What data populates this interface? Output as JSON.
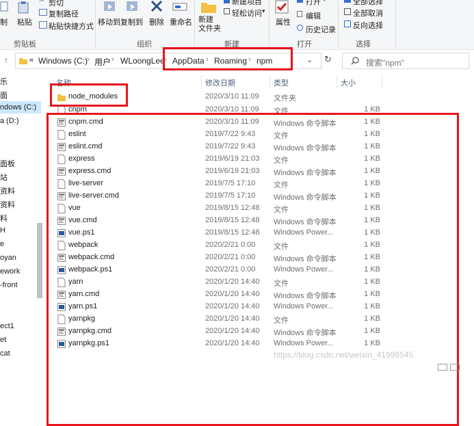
{
  "ribbon": {
    "clipboard": {
      "cut": "剪切",
      "copy_path": "复制路径",
      "paste_shortcut": "粘贴快捷方式",
      "copy": "制",
      "paste": "粘贴",
      "group": "剪贴板"
    },
    "organize": {
      "move_to": "移动到",
      "copy_to": "复制到",
      "delete": "删除",
      "rename": "重命名",
      "group": "组织"
    },
    "new": {
      "new_item": "新建项目",
      "easy_access": "轻松访问",
      "new_folder": "新建\n文件夹",
      "group": "新建"
    },
    "open": {
      "properties": "属性",
      "open": "打开",
      "edit": "编辑",
      "history": "历史记录",
      "group": "打开"
    },
    "select": {
      "select_all": "全部选择",
      "select_none": "全部取消",
      "invert": "反向选择",
      "group": "选择"
    }
  },
  "address": {
    "overflow": "«",
    "crumbs": [
      "Windows (C:)",
      "用户",
      "WLoongLee",
      "AppData",
      "Roaming",
      "npm"
    ],
    "search_placeholder": "搜索\"npm\""
  },
  "nav": {
    "items": [
      "乐",
      "面",
      "ndows (C:)",
      "a (D:)",
      "面板",
      "站",
      "资料",
      "资料",
      "料",
      "H",
      "e",
      "oyan",
      "ework",
      "-front",
      "ect1",
      "et",
      "cat"
    ],
    "selected_index": 2
  },
  "columns": {
    "name": "名称",
    "date": "修改日期",
    "type": "类型",
    "size": "大小"
  },
  "files": [
    {
      "name": "node_modules",
      "date": "2020/3/10 11:09",
      "type": "文件夹",
      "size": "",
      "icon": "folder-icon"
    },
    {
      "name": "cnpm",
      "date": "2020/3/10 11:09",
      "type": "文件",
      "size": "1 KB",
      "icon": "file-icon"
    },
    {
      "name": "cnpm.cmd",
      "date": "2020/3/10 11:09",
      "type": "Windows 命令脚本",
      "size": "1 KB",
      "icon": "cmd-icon"
    },
    {
      "name": "eslint",
      "date": "2019/7/22 9:43",
      "type": "文件",
      "size": "1 KB",
      "icon": "file-icon"
    },
    {
      "name": "eslint.cmd",
      "date": "2019/7/22 9:43",
      "type": "Windows 命令脚本",
      "size": "1 KB",
      "icon": "cmd-icon"
    },
    {
      "name": "express",
      "date": "2019/6/19 21:03",
      "type": "文件",
      "size": "1 KB",
      "icon": "file-icon"
    },
    {
      "name": "express.cmd",
      "date": "2019/6/19 21:03",
      "type": "Windows 命令脚本",
      "size": "1 KB",
      "icon": "cmd-icon"
    },
    {
      "name": "live-server",
      "date": "2019/7/5 17:10",
      "type": "文件",
      "size": "1 KB",
      "icon": "file-icon"
    },
    {
      "name": "live-server.cmd",
      "date": "2019/7/5 17:10",
      "type": "Windows 命令脚本",
      "size": "1 KB",
      "icon": "cmd-icon"
    },
    {
      "name": "vue",
      "date": "2019/8/15 12:48",
      "type": "文件",
      "size": "1 KB",
      "icon": "file-icon"
    },
    {
      "name": "vue.cmd",
      "date": "2019/8/15 12:48",
      "type": "Windows 命令脚本",
      "size": "1 KB",
      "icon": "cmd-icon"
    },
    {
      "name": "vue.ps1",
      "date": "2019/8/15 12:48",
      "type": "Windows Power...",
      "size": "1 KB",
      "icon": "ps1-icon"
    },
    {
      "name": "webpack",
      "date": "2020/2/21 0:00",
      "type": "文件",
      "size": "1 KB",
      "icon": "file-icon"
    },
    {
      "name": "webpack.cmd",
      "date": "2020/2/21 0:00",
      "type": "Windows 命令脚本",
      "size": "1 KB",
      "icon": "cmd-icon"
    },
    {
      "name": "webpack.ps1",
      "date": "2020/2/21 0:00",
      "type": "Windows Power...",
      "size": "1 KB",
      "icon": "ps1-icon"
    },
    {
      "name": "yarn",
      "date": "2020/1/20 14:40",
      "type": "文件",
      "size": "1 KB",
      "icon": "file-icon"
    },
    {
      "name": "yarn.cmd",
      "date": "2020/1/20 14:40",
      "type": "Windows 命令脚本",
      "size": "1 KB",
      "icon": "cmd-icon"
    },
    {
      "name": "yarn.ps1",
      "date": "2020/1/20 14:40",
      "type": "Windows Power...",
      "size": "1 KB",
      "icon": "ps1-icon"
    },
    {
      "name": "yarnpkg",
      "date": "2020/1/20 14:40",
      "type": "文件",
      "size": "1 KB",
      "icon": "file-icon"
    },
    {
      "name": "yarnpkg.cmd",
      "date": "2020/1/20 14:40",
      "type": "Windows 命令脚本",
      "size": "1 KB",
      "icon": "cmd-icon"
    },
    {
      "name": "yarnpkg.ps1",
      "date": "2020/1/20 14:40",
      "type": "Windows Power...",
      "size": "1 KB",
      "icon": "ps1-icon"
    }
  ],
  "watermark": "https://blog.csdn.net/weixin_41998545",
  "colors": {
    "highlight": "#e8141c",
    "folder": "#f2c144",
    "selection": "#cce8ff"
  }
}
